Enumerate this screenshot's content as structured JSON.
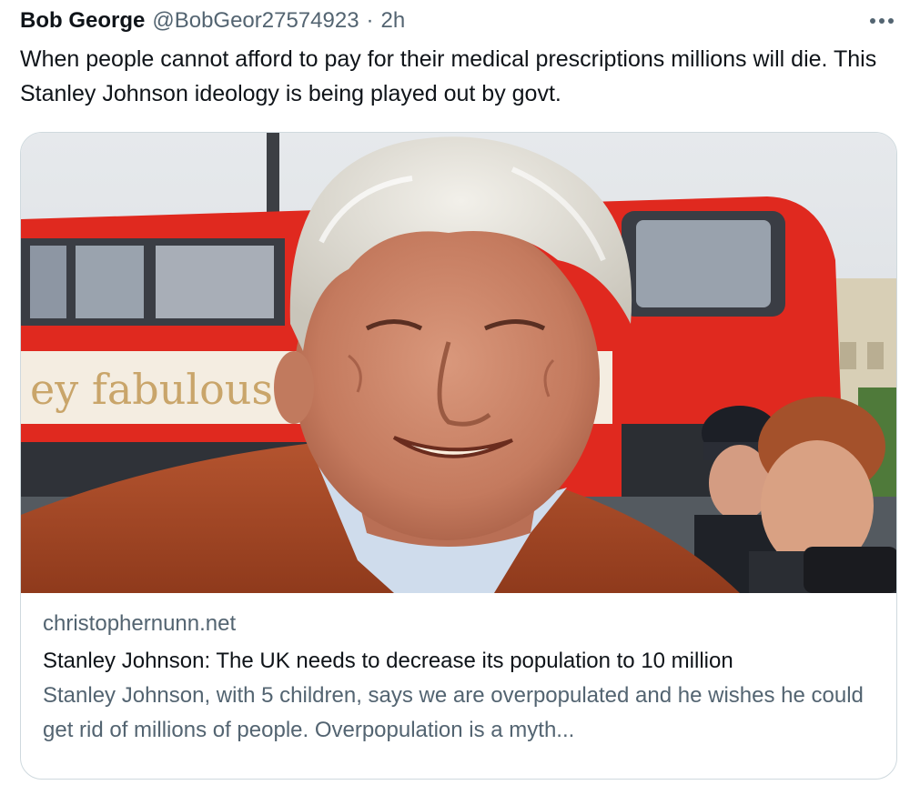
{
  "tweet": {
    "author": {
      "display_name": "Bob George",
      "handle": "@BobGeor27574923"
    },
    "separator": "·",
    "time": "2h",
    "more_icon": "more-horizontal-icon",
    "text": "When people cannot afford to pay for their medical prescriptions millions will die. This Stanley Johnson ideology is being played out by govt."
  },
  "card": {
    "domain": "christophernunn.net",
    "title": "Stanley Johnson: The UK needs to decrease its population to 10 million",
    "description": "Stanley Johnson, with 5 children, says we are overpopulated and he wishes he could get rid of millions of people. Overpopulation is a myth...",
    "image": {
      "bus_sign": "ey fabulous"
    }
  },
  "colors": {
    "text_primary": "#0f1419",
    "text_secondary": "#536471",
    "border": "#cfd9de",
    "bus_red": "#e0291f"
  }
}
